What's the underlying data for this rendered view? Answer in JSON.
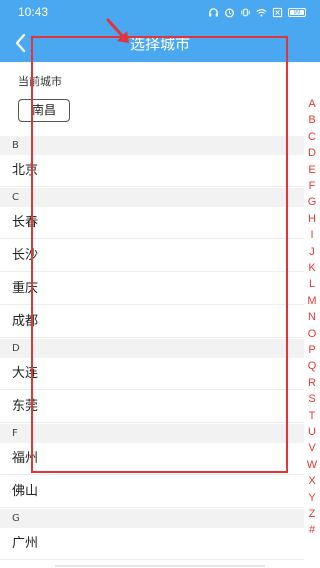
{
  "status_bar": {
    "time": "10:43",
    "battery": "99",
    "icons": [
      "headset-icon",
      "alarm-icon",
      "vibrate-icon",
      "wifi-icon",
      "sim-x-icon",
      "battery-icon"
    ]
  },
  "header": {
    "title": "选择城市",
    "back_icon": "chevron-left-icon"
  },
  "current_city": {
    "label": "当前城市",
    "value": "南昌"
  },
  "sections": [
    {
      "letter": "B",
      "cities": [
        "北京"
      ]
    },
    {
      "letter": "C",
      "cities": [
        "长春",
        "长沙",
        "重庆",
        "成都"
      ]
    },
    {
      "letter": "D",
      "cities": [
        "大连",
        "东莞"
      ]
    },
    {
      "letter": "F",
      "cities": [
        "福州",
        "佛山"
      ]
    },
    {
      "letter": "G",
      "cities": [
        "广州"
      ]
    }
  ],
  "index_letters": [
    "A",
    "B",
    "C",
    "D",
    "E",
    "F",
    "G",
    "H",
    "I",
    "J",
    "K",
    "L",
    "M",
    "N",
    "O",
    "P",
    "Q",
    "R",
    "S",
    "T",
    "U",
    "V",
    "W",
    "X",
    "Y",
    "Z",
    "#"
  ],
  "colors": {
    "header_bg": "#4aa8f0",
    "index_letters": "#e53935",
    "annotation": "#e0353a"
  }
}
